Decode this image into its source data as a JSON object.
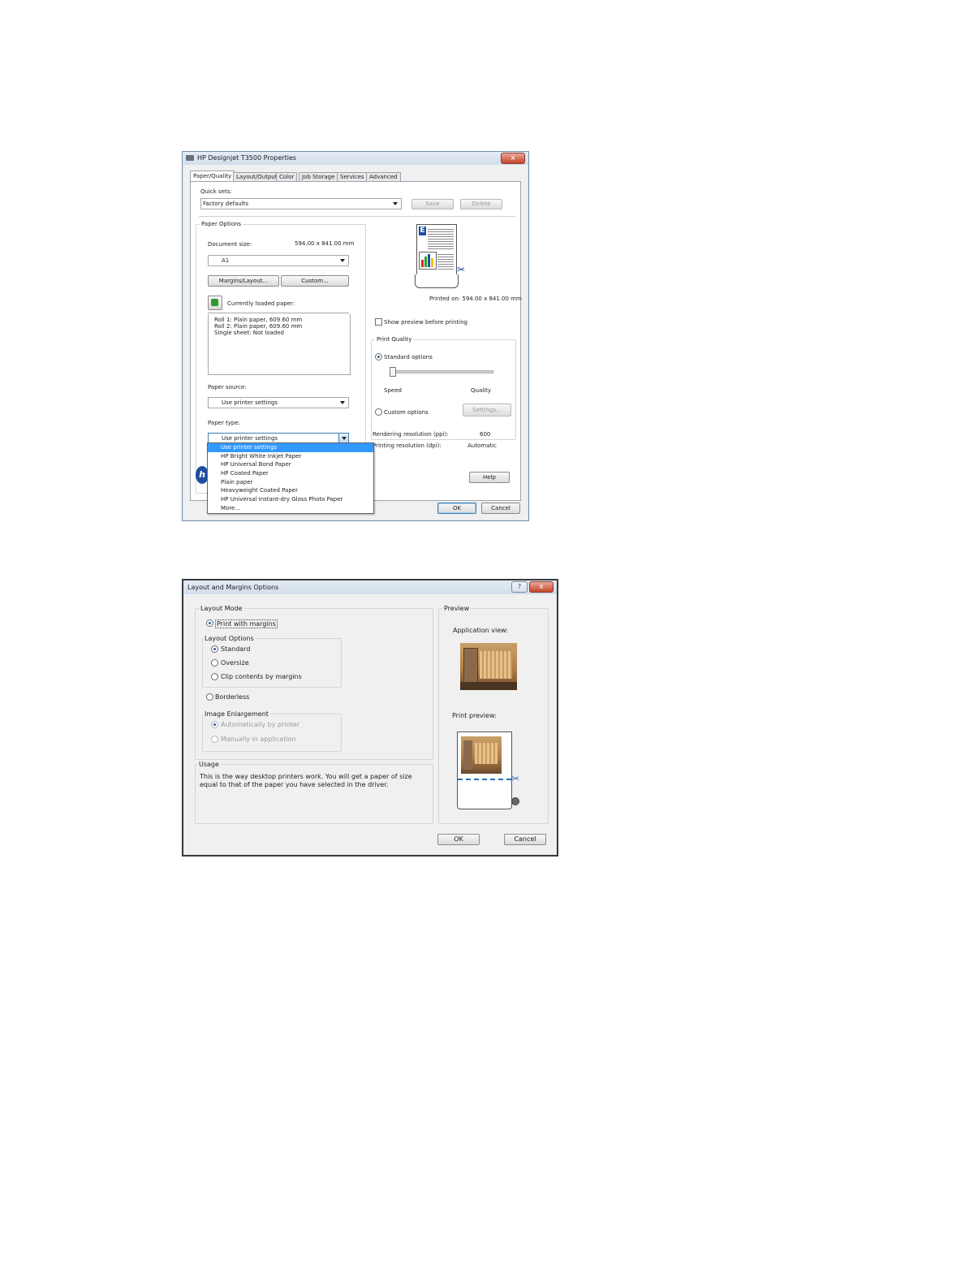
{
  "properties": {
    "title": "HP Designjet T3500 Properties",
    "close": "x",
    "tabs": [
      "Paper/Quality",
      "Layout/Output",
      "Color",
      "Job Storage",
      "Services",
      "Advanced"
    ],
    "quick_sets_label": "Quick sets:",
    "quick_sets_value": "Factory defaults",
    "save": "Save",
    "delete": "Delete",
    "paper_options_title": "Paper Options",
    "document_size_label": "Document size:",
    "document_size_value": "594.00 x 841.00 mm",
    "size_value": "A1",
    "margins_layout": "Margins/Layout...",
    "custom": "Custom...",
    "currently_loaded": "Currently loaded paper:",
    "loaded_lines": [
      "Roll 1: Plain paper, 609.60 mm",
      "Roll 2: Plain paper, 609.60 mm",
      "Single sheet: Not loaded"
    ],
    "paper_source_label": "Paper source:",
    "paper_source_value": "Use printer settings",
    "paper_type_label": "Paper type:",
    "paper_type_value": "Use printer settings",
    "paper_type_options": [
      "Use printer settings",
      "HP Bright White Inkjet Paper",
      "HP Universal Bond Paper",
      "HP Coated Paper",
      "Plain paper",
      "Heavyweight Coated Paper",
      "HP Universal Instant-dry Gloss Photo Paper",
      "More..."
    ],
    "printed_on": "Printed on: 594.00 x 841.00 mm",
    "show_preview": "Show preview before printing",
    "print_quality_title": "Print Quality",
    "standard_options": "Standard options",
    "speed": "Speed",
    "quality": "Quality",
    "slider_level": 0.0,
    "custom_options": "Custom options",
    "settings": "Settings...",
    "rendering_label": "Rendering resolution (ppi):",
    "rendering_value": "600",
    "printing_label": "Printing resolution (dpi):",
    "printing_value": "Automatic",
    "help": "Help",
    "ok": "OK",
    "cancel": "Cancel"
  },
  "layout_dialog": {
    "title": "Layout and Margins Options",
    "help": "?",
    "close": "x",
    "layout_mode_title": "Layout Mode",
    "print_with_margins": "Print with margins",
    "layout_options_title": "Layout Options",
    "standard": "Standard",
    "oversize": "Oversize",
    "clip_contents": "Clip contents by margins",
    "borderless": "Borderless",
    "image_enlargement_title": "Image Enlargement",
    "auto_by_printer": "Automatically by printer",
    "manually": "Manually in application",
    "usage_title": "Usage",
    "usage_text": "This is the way desktop printers work. You will get a paper of size equal to that of the paper you have selected in the driver.",
    "preview_title": "Preview",
    "application_view": "Application view:",
    "print_preview": "Print preview:",
    "ok": "OK",
    "cancel": "Cancel"
  }
}
